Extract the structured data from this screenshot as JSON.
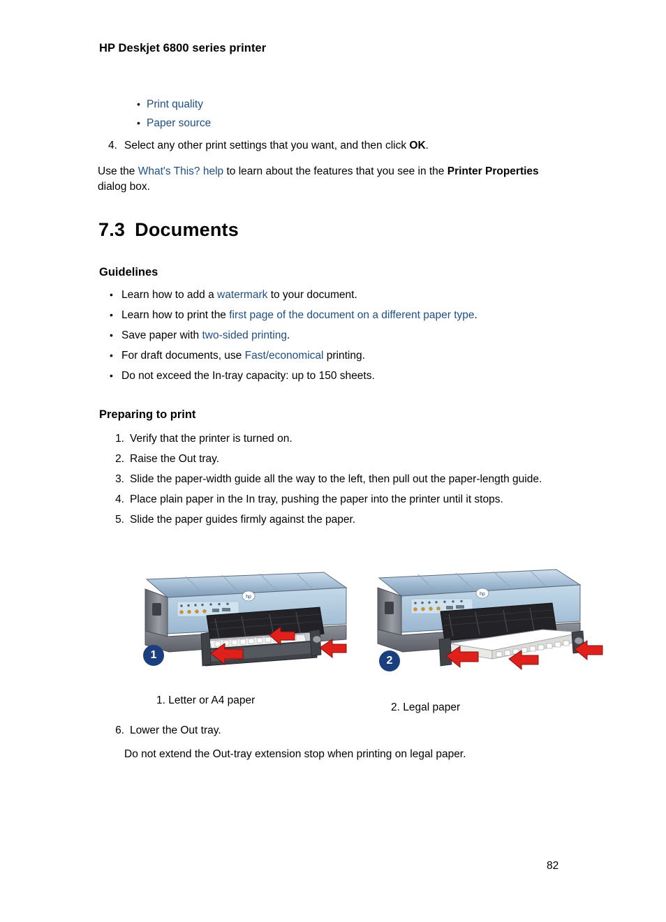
{
  "header": {
    "title": "HP Deskjet 6800 series printer"
  },
  "top_links": {
    "bullet_char": "•",
    "items": [
      {
        "label": "Print quality"
      },
      {
        "label": "Paper source"
      }
    ]
  },
  "step_four": {
    "number": "4.",
    "text_before": "Select any other print settings that you want, and then click ",
    "bold_text": "OK",
    "text_after": "."
  },
  "whats_this_paragraph": {
    "part1": "Use the ",
    "link": "What's This? help",
    "part2": " to learn about the features that you see in the ",
    "bold": "Printer Properties",
    "part3": " dialog box."
  },
  "section": {
    "number": "7.3",
    "title": "Documents"
  },
  "subheadings": {
    "guidelines": "Guidelines",
    "preparing": "Preparing to print"
  },
  "guidelines": {
    "bullet_char": "•",
    "items": [
      {
        "part1": "Learn how to add a ",
        "link": "watermark",
        "part2": " to your document."
      },
      {
        "part1": "Learn how to print the ",
        "link": "first page of the document on a different paper type",
        "part2": "."
      },
      {
        "part1": "Save paper with ",
        "link": "two-sided printing",
        "part2": "."
      },
      {
        "part1": "For draft documents, use ",
        "link": "Fast/economical",
        "part2": " printing."
      },
      {
        "part1": "Do not exceed the In-tray capacity: up to 150 sheets.",
        "link": "",
        "part2": ""
      }
    ]
  },
  "steps": [
    {
      "number": "1.",
      "text": "Verify that the printer is turned on."
    },
    {
      "number": "2.",
      "text": "Raise the Out tray."
    },
    {
      "number": "3.",
      "text": "Slide the paper-width guide all the way to the left, then pull out the paper-length guide."
    },
    {
      "number": "4.",
      "text": "Place plain paper in the In tray, pushing the paper into the printer until it stops."
    },
    {
      "number": "5.",
      "text": "Slide the paper guides firmly against the paper."
    }
  ],
  "step_six": {
    "number": "6.",
    "text": "Lower the Out tray."
  },
  "legal_note": "Do not extend the Out-tray extension stop when printing on legal paper.",
  "figures": [
    {
      "badge": "1",
      "caption": "1. Letter or A4 paper",
      "alt": "printer-letter-a4-illustration"
    },
    {
      "badge": "2",
      "caption": "2. Legal paper",
      "alt": "printer-legal-illustration"
    }
  ],
  "page_number": "82",
  "colors": {
    "link": "#1F4E82",
    "badge": "#1B3E7E",
    "arrow_red": "#E0201B",
    "printer_body_light": "#A9C5DD",
    "printer_body_dark": "#6E6E76"
  }
}
